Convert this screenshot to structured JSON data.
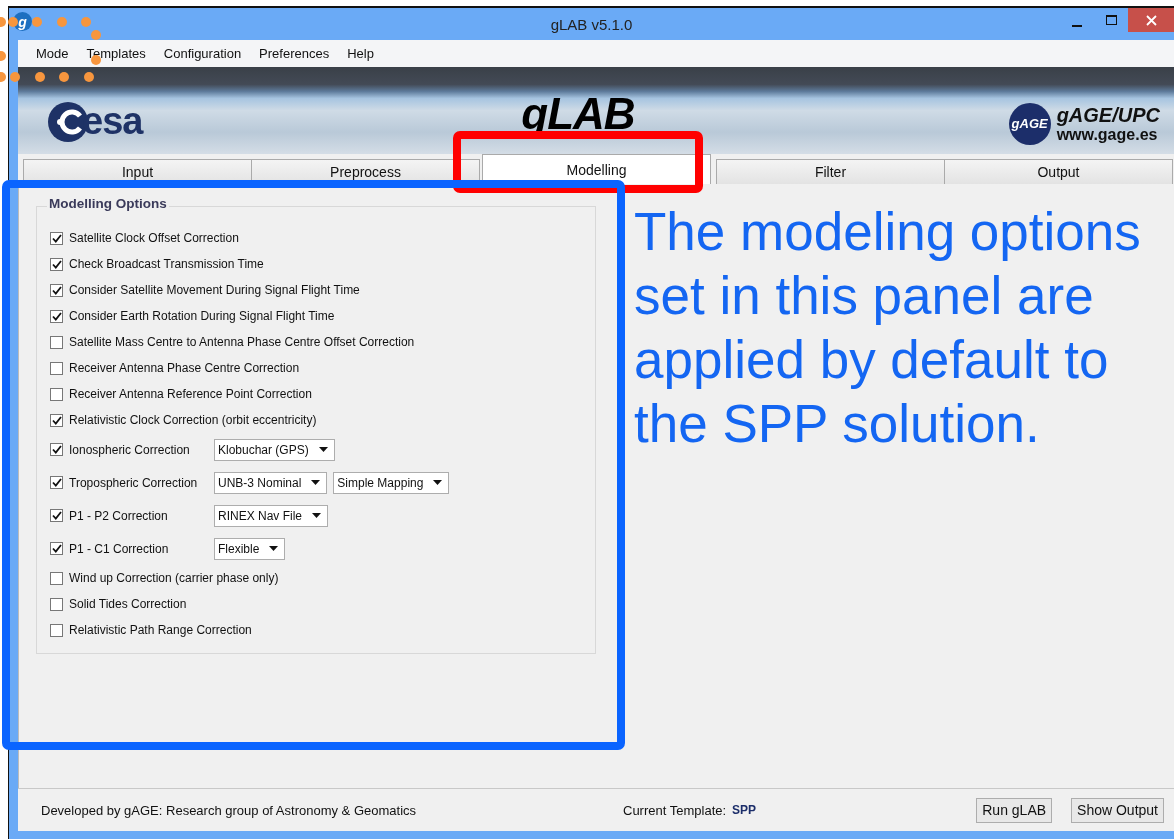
{
  "window": {
    "title": "gLAB v5.1.0",
    "app_icon": "g"
  },
  "menu": [
    "Mode",
    "Templates",
    "Configuration",
    "Preferences",
    "Help"
  ],
  "banner": {
    "left_logo": "esa",
    "title": "gLAB",
    "badge": "gAGE",
    "org": "gAGE/UPC",
    "url": "www.gage.es"
  },
  "tabs": [
    {
      "label": "Input",
      "selected": false
    },
    {
      "label": "Preprocess",
      "selected": false
    },
    {
      "label": "Modelling",
      "selected": true
    },
    {
      "label": "Filter",
      "selected": false
    },
    {
      "label": "Output",
      "selected": false
    }
  ],
  "modelling_options": {
    "title": "Modelling Options",
    "options": [
      {
        "kind": "checkbox",
        "label": "Satellite Clock Offset Correction",
        "checked": true
      },
      {
        "kind": "checkbox",
        "label": "Check Broadcast Transmission Time",
        "checked": true
      },
      {
        "kind": "checkbox",
        "label": "Consider Satellite Movement During Signal Flight Time",
        "checked": true
      },
      {
        "kind": "checkbox",
        "label": "Consider Earth Rotation During Signal Flight Time",
        "checked": true
      },
      {
        "kind": "checkbox",
        "label": "Satellite Mass Centre to Antenna Phase Centre Offset Correction",
        "checked": false
      },
      {
        "kind": "checkbox",
        "label": "Receiver Antenna Phase Centre Correction",
        "checked": false
      },
      {
        "kind": "checkbox",
        "label": "Receiver Antenna Reference Point Correction",
        "checked": false
      },
      {
        "kind": "checkbox",
        "label": "Relativistic Clock Correction (orbit eccentricity)",
        "checked": true
      },
      {
        "kind": "dropdown",
        "label": "Ionospheric Correction",
        "checked": true,
        "dropdowns": [
          "Klobuchar (GPS)"
        ]
      },
      {
        "kind": "dropdown",
        "label": "Tropospheric Correction",
        "checked": true,
        "dropdowns": [
          "UNB-3 Nominal",
          "Simple Mapping"
        ]
      },
      {
        "kind": "dropdown",
        "label": "P1 - P2 Correction",
        "checked": true,
        "dropdowns": [
          "RINEX Nav File"
        ]
      },
      {
        "kind": "dropdown",
        "label": "P1 - C1 Correction",
        "checked": true,
        "dropdowns": [
          "Flexible"
        ]
      },
      {
        "kind": "checkbox",
        "label": "Wind up Correction (carrier phase only)",
        "checked": false
      },
      {
        "kind": "checkbox",
        "label": "Solid Tides Correction",
        "checked": false
      },
      {
        "kind": "checkbox",
        "label": "Relativistic Path Range Correction",
        "checked": false
      }
    ]
  },
  "annotation": "The modeling options set in this panel are applied by default to the SPP solution.",
  "status_bar": {
    "credit": "Developed by gAGE: Research group of Astronomy & Geomatics",
    "template_label": "Current Template:",
    "template_value": "SPP",
    "buttons": [
      "Run gLAB",
      "Show Output"
    ]
  }
}
